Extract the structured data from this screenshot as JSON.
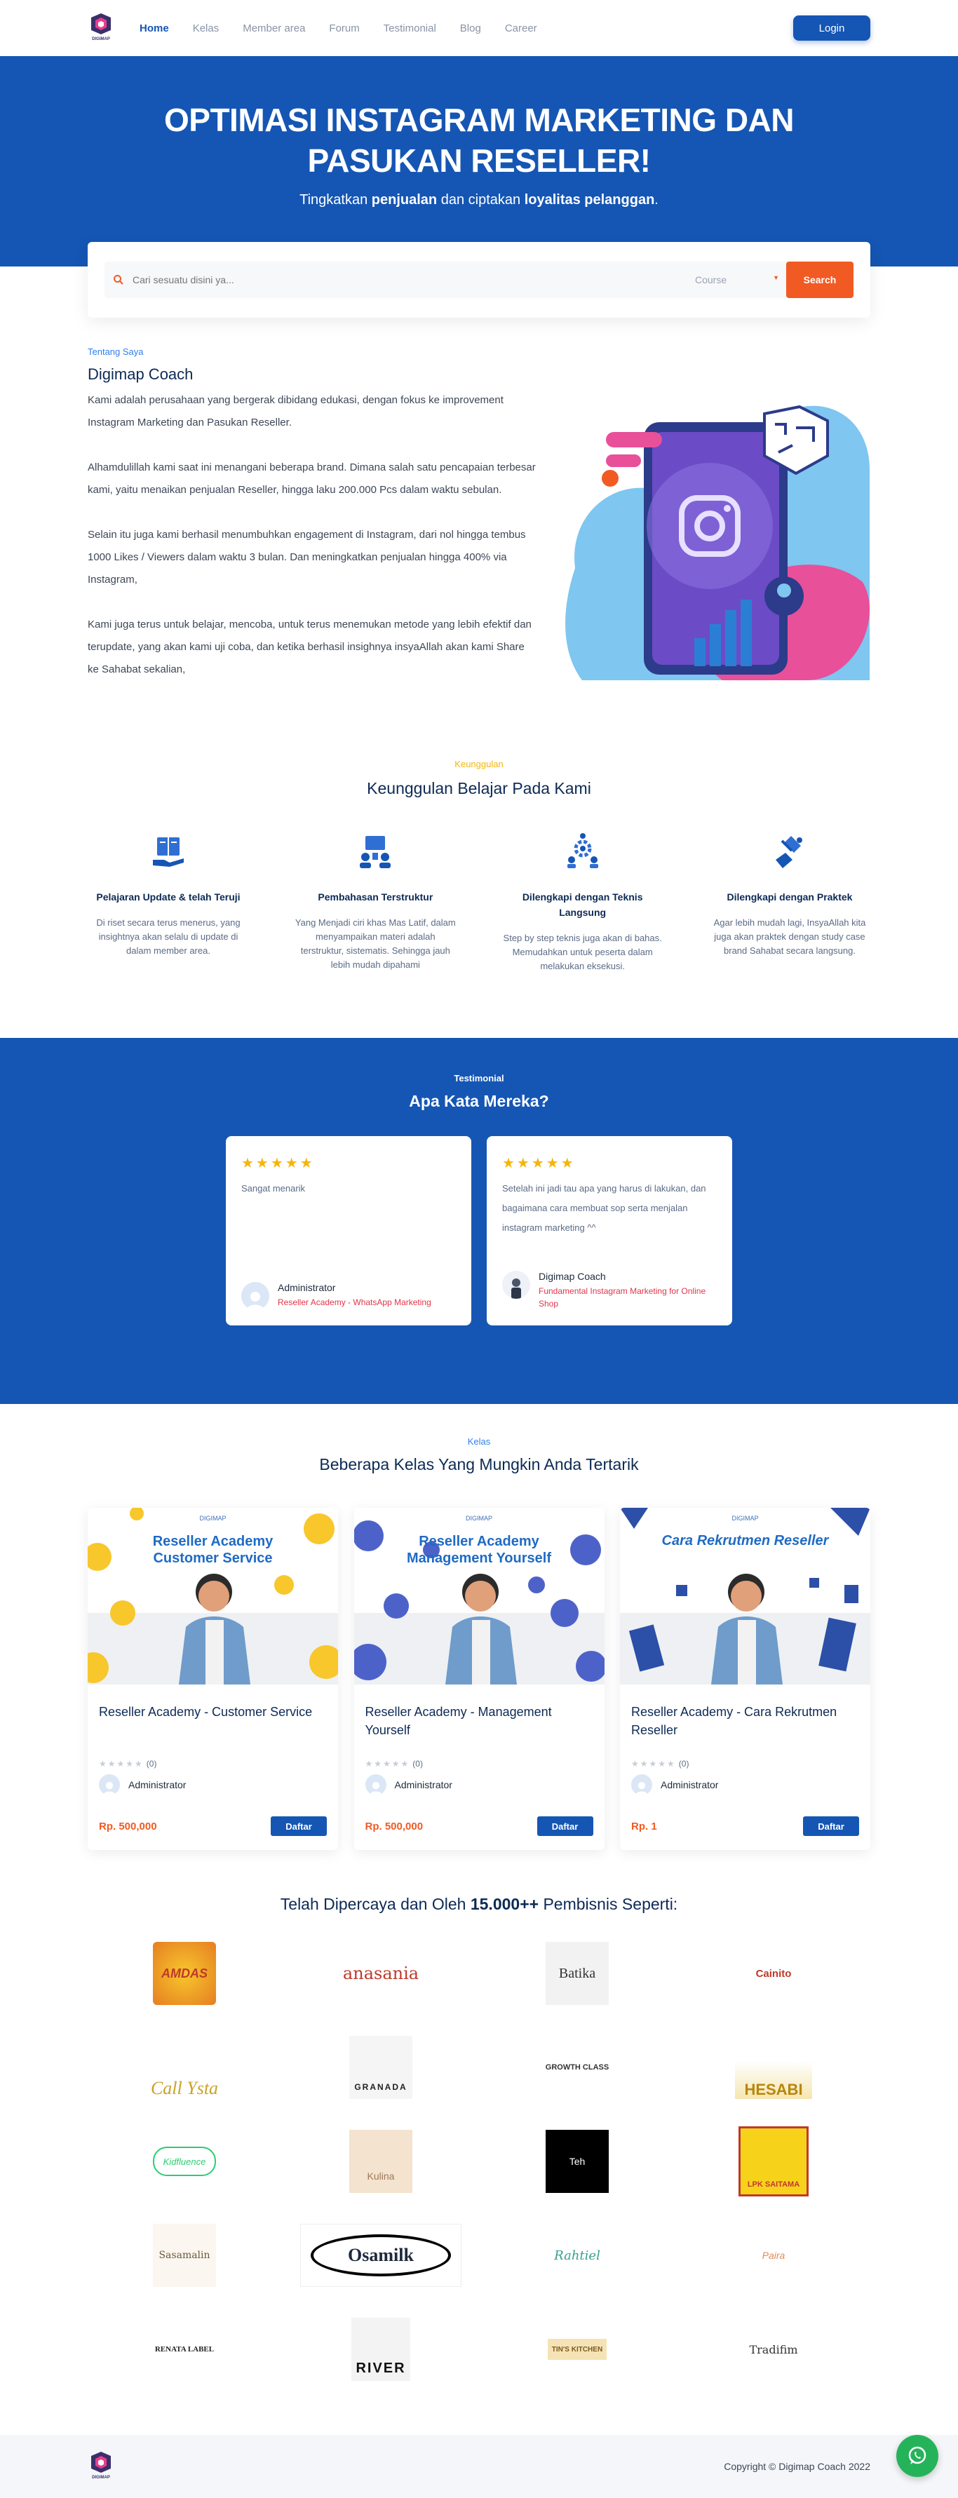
{
  "brand": {
    "logo_text": "DIGIMAP"
  },
  "nav": {
    "items": [
      "Home",
      "Kelas",
      "Member area",
      "Forum",
      "Testimonial",
      "Blog",
      "Career"
    ],
    "login": "Login"
  },
  "hero": {
    "title": "OPTIMASI INSTAGRAM MARKETING DAN PASUKAN RESELLER!",
    "sub_pre": "Tingkatkan ",
    "sub_b1": "penjualan",
    "sub_mid": " dan ciptakan ",
    "sub_b2": "loyalitas pelanggan",
    "sub_end": "."
  },
  "search": {
    "placeholder": "Cari sesuatu disini ya...",
    "select": "Course",
    "button": "Search"
  },
  "about": {
    "eyebrow": "Tentang Saya",
    "title": "Digimap Coach",
    "p1": "Kami adalah perusahaan yang bergerak dibidang edukasi, dengan fokus ke improvement Instagram Marketing dan Pasukan Reseller.",
    "p2": "Alhamdulillah kami saat ini menangani beberapa brand. Dimana salah satu pencapaian terbesar kami, yaitu menaikan penjualan Reseller, hingga laku 200.000 Pcs dalam waktu sebulan.",
    "p3": "Selain itu juga kami berhasil menumbuhkan engagement di Instagram, dari nol hingga tembus 1000 Likes / Viewers dalam waktu 3 bulan. Dan meningkatkan penjualan hingga 400% via Instagram,",
    "p4": "Kami juga terus untuk belajar, mencoba, untuk terus menemukan metode yang lebih efektif dan terupdate, yang akan kami uji coba, dan ketika berhasil insighnya insyaAllah akan kami Share ke Sahabat sekalian,"
  },
  "advantages": {
    "eyebrow": "Keunggulan",
    "title": "Keunggulan Belajar Pada Kami",
    "items": [
      {
        "title": "Pelajaran Update & telah Teruji",
        "desc": "Di riset secara terus menerus, yang insightnya akan selalu di update di dalam member area."
      },
      {
        "title": "Pembahasan Terstruktur",
        "desc": "Yang Menjadi ciri khas Mas Latif, dalam menyampaikan materi adalah terstruktur, sistematis. Sehingga jauh lebih mudah dipahami"
      },
      {
        "title": "Dilengkapi dengan Teknis Langsung",
        "desc": "Step by step teknis juga akan di bahas. Memudahkan untuk peserta dalam melakukan eksekusi."
      },
      {
        "title": "Dilengkapi dengan Praktek",
        "desc": "Agar lebih mudah lagi, InsyaAllah kita juga akan praktek dengan study case brand Sahabat secara langsung."
      }
    ]
  },
  "testimonials": {
    "eyebrow": "Testimonial",
    "title": "Apa Kata Mereka?",
    "items": [
      {
        "stars": "★★★★★",
        "quote": "Sangat menarik",
        "name": "Administrator",
        "role": "Reseller Academy - WhatsApp Marketing"
      },
      {
        "stars": "★★★★★",
        "quote": "Setelah ini jadi tau apa yang harus di lakukan, dan bagaimana cara membuat sop serta menjalan instagram marketing ^^",
        "name": "Digimap Coach",
        "role": "Fundamental Instagram Marketing for Online Shop"
      }
    ]
  },
  "courses": {
    "eyebrow": "Kelas",
    "title": "Beberapa Kelas Yang Mungkin Anda Tertarik",
    "items": [
      {
        "thumb_sub": "DIGIMAP",
        "thumb_title": "Reseller Academy Customer Service",
        "title": "Reseller Academy - Customer Service",
        "stars": "★★★★★",
        "count": "(0)",
        "author": "Administrator",
        "price": "Rp. 500,000",
        "button": "Daftar"
      },
      {
        "thumb_sub": "DIGIMAP",
        "thumb_title": "Reseller Academy Management Yourself",
        "title": "Reseller Academy - Management Yourself",
        "stars": "★★★★★",
        "count": "(0)",
        "author": "Administrator",
        "price": "Rp. 500,000",
        "button": "Daftar"
      },
      {
        "thumb_sub": "DIGIMAP",
        "thumb_title": "Cara Rekrutmen Reseller",
        "title": "Reseller Academy - Cara Rekrutmen Reseller",
        "stars": "★★★★★",
        "count": "(0)",
        "author": "Administrator",
        "price": "Rp. 1",
        "button": "Daftar"
      }
    ]
  },
  "trusted": {
    "title_pre": "Telah Dipercaya dan Oleh ",
    "title_b": "15.000++",
    "title_end": " Pembisnis Seperti:",
    "logos": [
      "AMDAS",
      "anasania",
      "Batika",
      "Cainito",
      "Call Ysta",
      "GRANADA",
      "GROWTH CLASS",
      "HESABI",
      "Kidfluence",
      "Kulina",
      "Teh",
      "LPK SAITAMA",
      "Sasamalin",
      "Osamilk",
      "Rahtiel",
      "Paira",
      "RENATA LABEL",
      "RIVER",
      "TIN'S KITCHEN",
      "Tradifim"
    ]
  },
  "footer": {
    "logo_text": "DIGIMAP",
    "copyright": "Copyright © Digimap Coach 2022"
  },
  "colors": {
    "primary": "#1556b4",
    "accent": "#f15a22",
    "star": "#f5b50a"
  }
}
